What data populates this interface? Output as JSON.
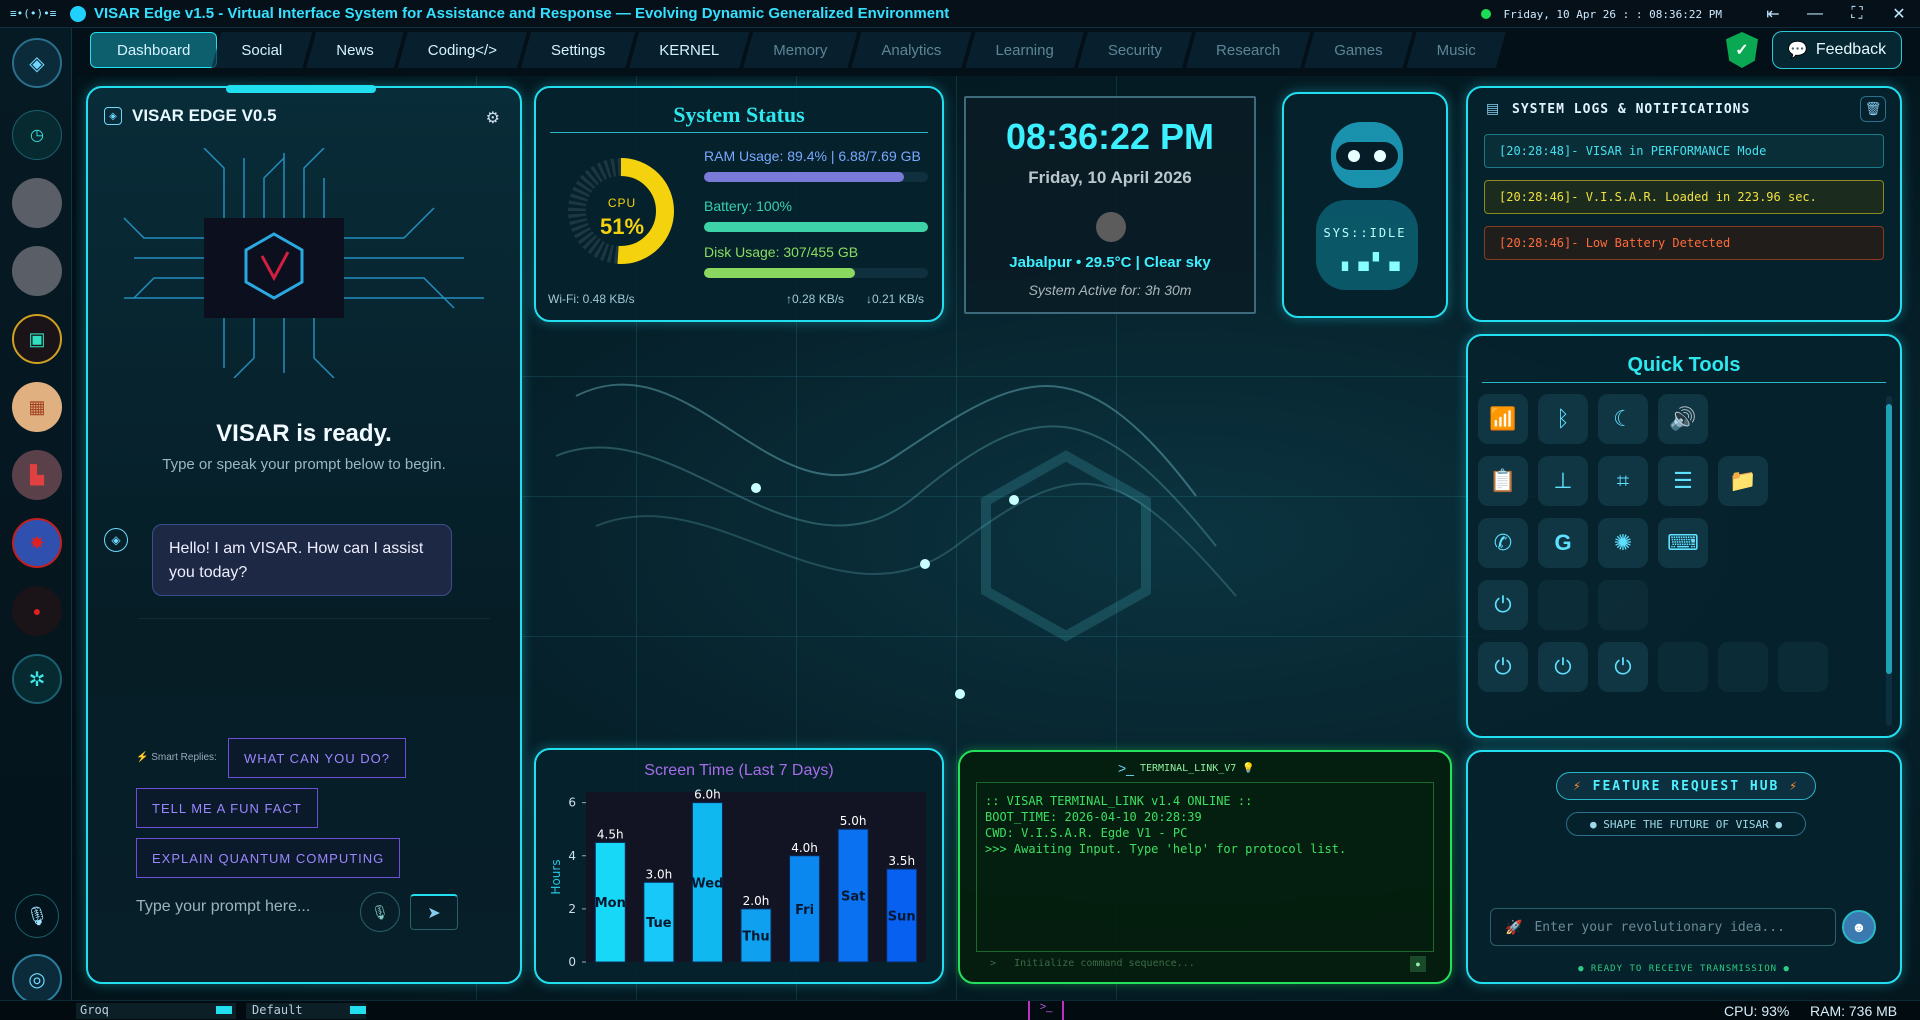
{
  "titlebar": {
    "logo": "≡•(•)•≡",
    "title": "VISAR Edge v1.5 - Virtual Interface System for Assistance and Response — Evolving Dynamic Generalized Environment",
    "datetime": "Friday, 10 Apr 26 : : 08:36:22 PM"
  },
  "nav": {
    "tabs": [
      {
        "label": "Dashboard",
        "active": true
      },
      {
        "label": "Social"
      },
      {
        "label": "News"
      },
      {
        "label": "Coding</>"
      },
      {
        "label": "Settings"
      },
      {
        "label": "KERNEL"
      },
      {
        "label": "Memory"
      },
      {
        "label": "Analytics"
      },
      {
        "label": "Learning"
      },
      {
        "label": "Security"
      },
      {
        "label": "Research"
      },
      {
        "label": "Games"
      },
      {
        "label": "Music"
      }
    ],
    "feedback_label": "Feedback"
  },
  "chat": {
    "header_title": "VISAR EDGE V0.5",
    "ready_title": "VISAR is ready.",
    "ready_sub": "Type or speak your prompt below to begin.",
    "bot_message": "Hello! I am VISAR. How can I assist you today?",
    "smart_replies_label": "Smart Replies:",
    "replies": [
      "WHAT CAN YOU DO?",
      "TELL ME A FUN FACT",
      "EXPLAIN QUANTUM COMPUTING"
    ],
    "input_placeholder": "Type your prompt here..."
  },
  "system_status": {
    "title": "System Status",
    "cpu_label": "CPU",
    "cpu_value": "51%",
    "cpu_percent": 51,
    "ram_label": "RAM Usage: 89.4% | 6.88/7.69 GB",
    "ram_percent": 89.4,
    "battery_label": "Battery: 100%",
    "battery_percent": 100,
    "disk_label": "Disk Usage: 307/455 GB",
    "disk_percent": 67.5,
    "wifi": "Wi-Fi: 0.48 KB/s",
    "upload": "↑0.28 KB/s",
    "download": "↓0.21 KB/s"
  },
  "clock": {
    "time": "08:36:22 PM",
    "date": "Friday, 10 April 2026",
    "weather": "Jabalpur • 29.5°C | Clear sky",
    "uptime": "System Active for: 3h 30m"
  },
  "robot": {
    "status": "SYS::IDLE"
  },
  "logs": {
    "title": "SYSTEM LOGS & NOTIFICATIONS",
    "entries": [
      {
        "text": "[20:28:48]- VISAR in PERFORMANCE Mode"
      },
      {
        "text": "[20:28:46]- V.I.S.A.R. Loaded in 223.96 sec."
      },
      {
        "text": "[20:28:46]- Low Battery Detected"
      }
    ]
  },
  "quick_tools": {
    "title": "Quick Tools"
  },
  "screen_time": {
    "chart_data": {
      "type": "bar",
      "title": "Screen Time (Last 7 Days)",
      "ylabel": "Hours",
      "categories": [
        "Mon",
        "Tue",
        "Wed",
        "Thu",
        "Fri",
        "Sat",
        "Sun"
      ],
      "values": [
        4.5,
        3.0,
        6.0,
        2.0,
        4.0,
        5.0,
        3.5
      ],
      "value_labels": [
        "4.5h",
        "3.0h",
        "6.0h",
        "2.0h",
        "4.0h",
        "5.0h",
        "3.5h"
      ],
      "yticks": [
        "0",
        "2",
        "4",
        "6"
      ],
      "ylim": [
        0,
        6.4
      ]
    }
  },
  "terminal": {
    "title": "TERMINAL_LINK_V7",
    "lines": [
      ":: VISAR TERMINAL_LINK v1.4 ONLINE ::",
      "BOOT_TIME: 2026-04-10 20:28:39",
      "CWD: V.I.S.A.R. Egde V1 - PC",
      ">>> Awaiting Input. Type 'help' for protocol list."
    ],
    "input_placeholder": "Initialize command sequence..."
  },
  "feature_hub": {
    "title": "FEATURE REQUEST HUB",
    "subtitle": "● SHAPE THE FUTURE OF VISAR ●",
    "input_placeholder": "Enter your revolutionary idea...",
    "status": "● READY TO RECEIVE TRANSMISSION ●"
  },
  "bottombar": {
    "provider": "Groq",
    "model": "Default",
    "cpu": "CPU: 93%",
    "ram": "RAM: 736 MB"
  }
}
